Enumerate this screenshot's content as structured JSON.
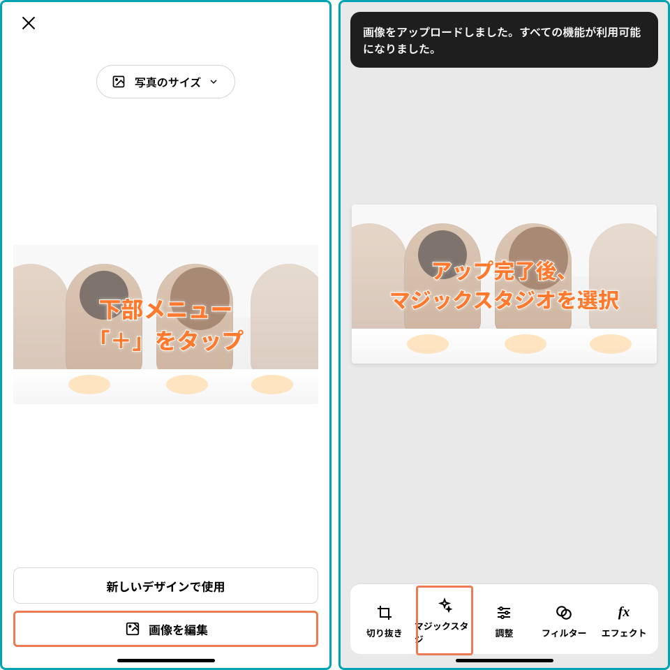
{
  "left": {
    "size_chip_label": "写真のサイズ",
    "overlay_line1": "下部メニュー",
    "overlay_line2": "「＋」をタップ",
    "btn_use_in_design": "新しいデザインで使用",
    "btn_edit_image": "画像を編集"
  },
  "right": {
    "toast": "画像をアップロードしました。すべての機能が利用可能になりました。",
    "overlay_line1": "アップ完了後、",
    "overlay_line2": "マジックスタジオを選択",
    "tools": {
      "crop": "切り抜き",
      "magic": "マジックスタジ",
      "adjust": "調整",
      "filter": "フィルター",
      "effect": "エフェクト"
    }
  }
}
